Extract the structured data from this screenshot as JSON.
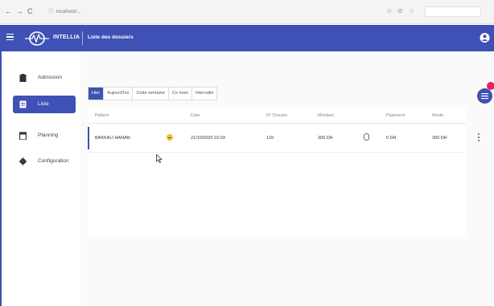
{
  "browser": {
    "url": "localhost/...",
    "icons": [
      "back-arrow",
      "forward-arrow",
      "reload",
      "lock",
      "extensions",
      "bookmark"
    ]
  },
  "header": {
    "brand": "INTELLIA",
    "page_title": "Liste des dossiers",
    "colors": {
      "primary": "#3f51b5",
      "badge": "#e91e63",
      "emoji": "#f2c230"
    }
  },
  "sidebar": {
    "items": [
      {
        "label": "Admission",
        "icon": "clipboard-icon",
        "active": false
      },
      {
        "label": "Liste",
        "icon": "list-icon",
        "active": true
      },
      {
        "label": "Planning",
        "icon": "calendar-icon",
        "active": false
      },
      {
        "label": "Configuration",
        "icon": "gear-icon",
        "active": false
      }
    ]
  },
  "filters": {
    "tabs": [
      "Hier",
      "Aujourd'hui",
      "Cette semaine",
      "Ce mois",
      "Intervalle"
    ],
    "active": "Hier"
  },
  "table": {
    "headers": [
      "Patient",
      "Date",
      "N° Dossier",
      "Montant",
      "Paiement",
      "Reste"
    ],
    "rows": [
      {
        "patient": "BAKKALI HANAN",
        "date": "21/10/2020 16:03",
        "dossier": "119",
        "montant": "300 DH",
        "paiement": "0 DH",
        "reste": "300 DH"
      }
    ]
  }
}
